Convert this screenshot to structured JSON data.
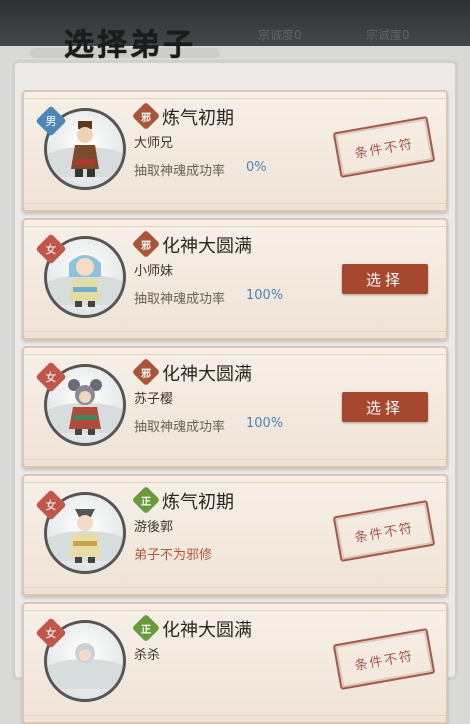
{
  "header": {
    "title": "选择弟子",
    "faded_left": "宗诚度0",
    "faded_right": "宗诚度0"
  },
  "disciples": [
    {
      "gender": "男",
      "gender_kind": "male",
      "alignment": "邪",
      "alignment_kind": "evil",
      "realm": "炼气初期",
      "name": "大师兄",
      "rate_label": "抽取神魂成功率",
      "rate_value": "0%",
      "action": "stamp",
      "stamp_text": "条件不符"
    },
    {
      "gender": "女",
      "gender_kind": "female",
      "alignment": "邪",
      "alignment_kind": "evil",
      "realm": "化神大圆满",
      "name": "小师妹",
      "rate_label": "抽取神魂成功率",
      "rate_value": "100%",
      "action": "button",
      "button_label": "选择"
    },
    {
      "gender": "女",
      "gender_kind": "female",
      "alignment": "邪",
      "alignment_kind": "evil",
      "realm": "化神大圆满",
      "name": "苏子樱",
      "rate_label": "抽取神魂成功率",
      "rate_value": "100%",
      "action": "button",
      "button_label": "选择"
    },
    {
      "gender": "女",
      "gender_kind": "female",
      "alignment": "正",
      "alignment_kind": "righteous",
      "realm": "炼气初期",
      "name": "游後郭",
      "note": "弟子不为邪修",
      "action": "stamp",
      "stamp_text": "条件不符"
    },
    {
      "gender": "女",
      "gender_kind": "female",
      "alignment": "正",
      "alignment_kind": "righteous",
      "realm": "化神大圆满",
      "name": "杀杀",
      "action": "stamp",
      "stamp_text": "条件不符"
    }
  ]
}
